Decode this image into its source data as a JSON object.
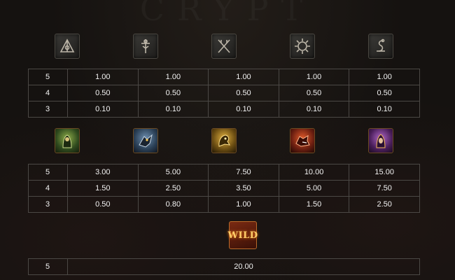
{
  "background_title": "CRYPT",
  "low_symbols": {
    "icons": [
      "triangle-rune-icon",
      "staff-rune-icon",
      "crossed-blades-rune-icon",
      "sun-rune-icon",
      "serpent-rune-icon"
    ],
    "rows": [
      {
        "count": "5",
        "values": [
          "1.00",
          "1.00",
          "1.00",
          "1.00",
          "1.00"
        ]
      },
      {
        "count": "4",
        "values": [
          "0.50",
          "0.50",
          "0.50",
          "0.50",
          "0.50"
        ]
      },
      {
        "count": "3",
        "values": [
          "0.10",
          "0.10",
          "0.10",
          "0.10",
          "0.10"
        ]
      }
    ]
  },
  "high_symbols": {
    "icons": [
      "green-warrior-icon",
      "blue-beast-icon",
      "golden-dragon-icon",
      "red-dragon-icon",
      "purple-witch-icon"
    ],
    "colors": [
      "#2f4a1e",
      "#2a3f55",
      "#6b4d12",
      "#6a1e10",
      "#4a1e5a"
    ],
    "rows": [
      {
        "count": "5",
        "values": [
          "3.00",
          "5.00",
          "7.50",
          "10.00",
          "15.00"
        ]
      },
      {
        "count": "4",
        "values": [
          "1.50",
          "2.50",
          "3.50",
          "5.00",
          "7.50"
        ]
      },
      {
        "count": "3",
        "values": [
          "0.50",
          "0.80",
          "1.00",
          "1.50",
          "2.50"
        ]
      }
    ]
  },
  "wild": {
    "label": "WILD",
    "rows": [
      {
        "count": "5",
        "value": "20.00"
      }
    ]
  },
  "colors": {
    "grid_border": "#4b4845",
    "text": "#f2f2f2",
    "accent_gold": "#ffcf6a"
  }
}
